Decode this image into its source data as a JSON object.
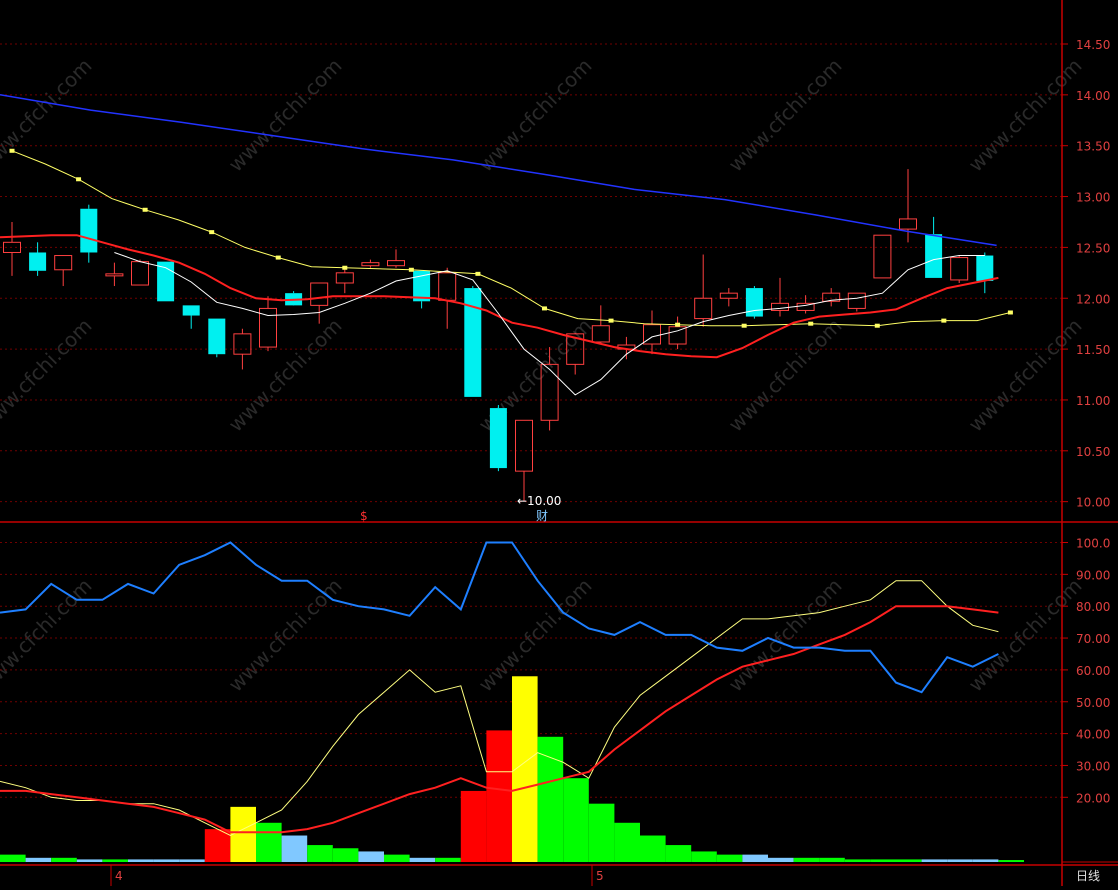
{
  "chart_data": [
    {
      "type": "candlestick",
      "y_ticks": [
        "14.50",
        "14.00",
        "13.50",
        "13.00",
        "12.50",
        "12.00",
        "11.50",
        "11.00",
        "10.50",
        "10.00"
      ],
      "ylim": [
        9.8,
        14.7
      ],
      "annotations": {
        "low_marker": "←10.00",
        "event_s": "$",
        "event_cai": "财"
      },
      "candles": [
        {
          "o": 12.45,
          "h": 12.75,
          "l": 12.22,
          "c": 12.55
        },
        {
          "o": 12.45,
          "h": 12.55,
          "l": 12.22,
          "c": 12.27
        },
        {
          "o": 12.28,
          "h": 12.42,
          "l": 12.12,
          "c": 12.42
        },
        {
          "o": 12.88,
          "h": 12.92,
          "l": 12.35,
          "c": 12.45
        },
        {
          "o": 12.22,
          "h": 12.35,
          "l": 12.12,
          "c": 12.24
        },
        {
          "o": 12.13,
          "h": 12.38,
          "l": 12.13,
          "c": 12.36
        },
        {
          "o": 12.36,
          "h": 12.36,
          "l": 11.97,
          "c": 11.97
        },
        {
          "o": 11.93,
          "h": 11.93,
          "l": 11.7,
          "c": 11.83
        },
        {
          "o": 11.8,
          "h": 11.8,
          "l": 11.42,
          "c": 11.45
        },
        {
          "o": 11.45,
          "h": 11.7,
          "l": 11.3,
          "c": 11.65
        },
        {
          "o": 11.52,
          "h": 12.02,
          "l": 11.48,
          "c": 11.9
        },
        {
          "o": 12.05,
          "h": 12.07,
          "l": 11.95,
          "c": 11.93
        },
        {
          "o": 11.93,
          "h": 12.15,
          "l": 11.75,
          "c": 12.15
        },
        {
          "o": 12.15,
          "h": 12.3,
          "l": 12.05,
          "c": 12.25
        },
        {
          "o": 12.32,
          "h": 12.38,
          "l": 12.3,
          "c": 12.35
        },
        {
          "o": 12.32,
          "h": 12.48,
          "l": 12.3,
          "c": 12.37
        },
        {
          "o": 12.27,
          "h": 12.27,
          "l": 11.9,
          "c": 11.97
        },
        {
          "o": 11.98,
          "h": 12.3,
          "l": 11.7,
          "c": 12.25
        },
        {
          "o": 12.1,
          "h": 12.12,
          "l": 11.03,
          "c": 11.03
        },
        {
          "o": 10.92,
          "h": 10.95,
          "l": 10.3,
          "c": 10.33
        },
        {
          "o": 10.3,
          "h": 10.8,
          "l": 10.0,
          "c": 10.8
        },
        {
          "o": 10.8,
          "h": 11.52,
          "l": 10.7,
          "c": 11.35
        },
        {
          "o": 11.35,
          "h": 11.66,
          "l": 11.25,
          "c": 11.65
        },
        {
          "o": 11.57,
          "h": 11.93,
          "l": 11.55,
          "c": 11.73
        },
        {
          "o": 11.5,
          "h": 11.62,
          "l": 11.4,
          "c": 11.54
        },
        {
          "o": 11.55,
          "h": 11.88,
          "l": 11.45,
          "c": 11.74
        },
        {
          "o": 11.55,
          "h": 11.82,
          "l": 11.5,
          "c": 11.72
        },
        {
          "o": 11.8,
          "h": 12.43,
          "l": 11.72,
          "c": 12.0
        },
        {
          "o": 12.0,
          "h": 12.1,
          "l": 11.92,
          "c": 12.05
        },
        {
          "o": 12.1,
          "h": 12.12,
          "l": 11.8,
          "c": 11.82
        },
        {
          "o": 11.88,
          "h": 12.2,
          "l": 11.82,
          "c": 11.95
        },
        {
          "o": 11.88,
          "h": 12.03,
          "l": 11.85,
          "c": 11.95
        },
        {
          "o": 11.97,
          "h": 12.1,
          "l": 11.92,
          "c": 12.05
        },
        {
          "o": 11.9,
          "h": 12.05,
          "l": 11.87,
          "c": 12.05
        },
        {
          "o": 12.2,
          "h": 12.62,
          "l": 12.2,
          "c": 12.62
        },
        {
          "o": 12.68,
          "h": 13.27,
          "l": 12.55,
          "c": 12.78
        },
        {
          "o": 12.63,
          "h": 12.8,
          "l": 12.2,
          "c": 12.2
        },
        {
          "o": 12.18,
          "h": 12.42,
          "l": 12.15,
          "c": 12.4
        },
        {
          "o": 12.42,
          "h": 12.45,
          "l": 12.05,
          "c": 12.17
        }
      ],
      "series": [
        {
          "color": "#ffffff",
          "values": [
            null,
            null,
            null,
            null,
            12.45,
            12.36,
            12.3,
            12.16,
            11.96,
            11.9,
            11.83,
            11.84,
            11.86,
            11.95,
            12.05,
            12.17,
            12.22,
            12.27,
            12.18,
            11.85,
            11.5,
            11.3,
            11.05,
            11.2,
            11.45,
            11.62,
            11.68,
            11.77,
            11.83,
            11.88,
            11.9,
            11.93,
            11.98,
            12.0,
            12.05,
            12.28,
            12.38,
            12.42,
            12.42
          ]
        },
        {
          "color": "#ff2020",
          "values": [
            12.6,
            12.61,
            12.62,
            12.62,
            12.55,
            12.48,
            12.42,
            12.35,
            12.24,
            12.1,
            12.0,
            11.98,
            11.99,
            12.02,
            12.02,
            12.02,
            12.01,
            12.0,
            11.95,
            11.88,
            11.76,
            11.71,
            11.64,
            11.58,
            11.52,
            11.48,
            11.45,
            11.43,
            11.42,
            11.51,
            11.64,
            11.76,
            11.82,
            11.84,
            11.86,
            11.89,
            12.0,
            12.1,
            12.15,
            12.2
          ]
        },
        {
          "color": "#ffff66",
          "marked": true,
          "values": [
            13.45,
            13.32,
            13.17,
            12.98,
            12.87,
            12.77,
            12.65,
            12.5,
            12.4,
            12.31,
            12.3,
            12.29,
            12.28,
            12.26,
            12.24,
            12.1,
            11.9,
            11.8,
            11.78,
            11.75,
            11.74,
            11.73,
            11.73,
            11.74,
            11.75,
            11.74,
            11.73,
            11.77,
            11.78,
            11.78,
            11.86
          ]
        },
        {
          "color": "#2233ff",
          "values": [
            14.0,
            13.85,
            13.73,
            13.6,
            13.47,
            13.36,
            13.22,
            13.07,
            12.97,
            12.82,
            12.66,
            12.52
          ]
        }
      ]
    },
    {
      "type": "bar+line",
      "y_ticks": [
        "100.0",
        "90.00",
        "80.00",
        "70.00",
        "60.00",
        "50.00",
        "40.00",
        "30.00",
        "20.00"
      ],
      "ylim": [
        0,
        106
      ],
      "series": [
        {
          "color": "#1e7fff",
          "values": [
            78,
            79,
            87,
            82,
            82,
            87,
            84,
            93,
            96,
            100,
            93,
            88,
            88,
            82,
            80,
            79,
            77,
            86,
            79,
            100,
            100,
            88,
            78,
            73,
            71,
            75,
            71,
            71,
            67,
            66,
            70,
            67,
            67,
            66,
            66,
            56,
            53,
            64,
            61,
            65
          ]
        },
        {
          "color": "#ffff80",
          "values": [
            25,
            23,
            20,
            19,
            19,
            18,
            18,
            16,
            12,
            8,
            12,
            16,
            25,
            36,
            46,
            53,
            60,
            53,
            55,
            28,
            28,
            34,
            31,
            26,
            42,
            52,
            58,
            64,
            70,
            76,
            76,
            77,
            78,
            80,
            82,
            88,
            88,
            80,
            74,
            72
          ]
        },
        {
          "color": "#ff2020",
          "values": [
            22,
            22,
            21,
            20,
            19,
            18,
            17,
            15,
            13,
            9,
            9,
            9,
            10,
            12,
            15,
            18,
            21,
            23,
            26,
            23,
            22,
            24,
            26,
            28,
            35,
            41,
            47,
            52,
            57,
            61,
            63,
            65,
            68,
            71,
            75,
            80,
            80,
            80,
            79,
            78
          ]
        }
      ],
      "bars": [
        {
          "v": 2,
          "c": "#00ff00"
        },
        {
          "v": 1,
          "c": "#80c8ff"
        },
        {
          "v": 1,
          "c": "#00ff00"
        },
        {
          "v": 0.5,
          "c": "#80c8ff"
        },
        {
          "v": 0.5,
          "c": "#00ff00"
        },
        {
          "v": 0.5,
          "c": "#80c8ff"
        },
        {
          "v": 0.5,
          "c": "#80c8ff"
        },
        {
          "v": 0.5,
          "c": "#80c8ff"
        },
        {
          "v": 10,
          "c": "#ff0000"
        },
        {
          "v": 17,
          "c": "#ffff00"
        },
        {
          "v": 12,
          "c": "#00ff00"
        },
        {
          "v": 8,
          "c": "#80c8ff"
        },
        {
          "v": 5,
          "c": "#00ff00"
        },
        {
          "v": 4,
          "c": "#00ff00"
        },
        {
          "v": 3,
          "c": "#80c8ff"
        },
        {
          "v": 2,
          "c": "#00ff00"
        },
        {
          "v": 1,
          "c": "#80c8ff"
        },
        {
          "v": 1,
          "c": "#00ff00"
        },
        {
          "v": 22,
          "c": "#ff0000"
        },
        {
          "v": 41,
          "c": "#ff0000"
        },
        {
          "v": 58,
          "c": "#ffff00"
        },
        {
          "v": 39,
          "c": "#00ff00"
        },
        {
          "v": 26,
          "c": "#00ff00"
        },
        {
          "v": 18,
          "c": "#00ff00"
        },
        {
          "v": 12,
          "c": "#00ff00"
        },
        {
          "v": 8,
          "c": "#00ff00"
        },
        {
          "v": 5,
          "c": "#00ff00"
        },
        {
          "v": 3,
          "c": "#00ff00"
        },
        {
          "v": 2,
          "c": "#00ff00"
        },
        {
          "v": 2,
          "c": "#80c8ff"
        },
        {
          "v": 1,
          "c": "#80c8ff"
        },
        {
          "v": 1,
          "c": "#00ff00"
        },
        {
          "v": 1,
          "c": "#00ff00"
        },
        {
          "v": 0.5,
          "c": "#00ff00"
        },
        {
          "v": 0.5,
          "c": "#00ff00"
        },
        {
          "v": 0.5,
          "c": "#00ff00"
        },
        {
          "v": 0.5,
          "c": "#80c8ff"
        },
        {
          "v": 0.5,
          "c": "#80c8ff"
        },
        {
          "v": 0.5,
          "c": "#80c8ff"
        },
        {
          "v": 0.3,
          "c": "#00ff00"
        }
      ]
    }
  ],
  "x_ticks": [
    "4",
    "5"
  ],
  "period_label": "日线",
  "watermark": "www.cfchi.com",
  "colors": {
    "up": "#ff4040",
    "down": "#00f0f0",
    "grid": "#700000",
    "axis": "#c80000",
    "tick_text": "#e04040"
  }
}
